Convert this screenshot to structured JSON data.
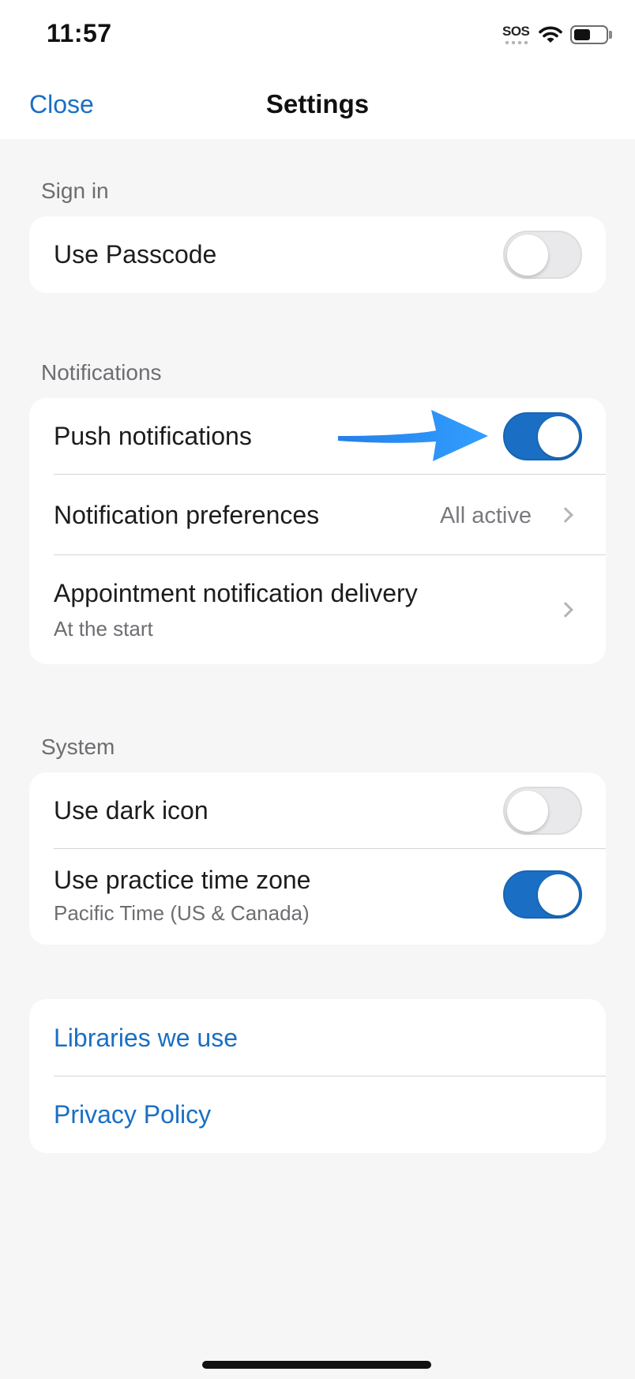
{
  "status_bar": {
    "time": "11:57",
    "sos_label": "SOS",
    "battery_level": 0.45,
    "wifi_icon": "wifi-icon",
    "battery_icon": "battery-icon"
  },
  "nav": {
    "close_label": "Close",
    "title": "Settings"
  },
  "sections": {
    "sign_in": {
      "header": "Sign in",
      "use_passcode": {
        "label": "Use Passcode",
        "enabled": false
      }
    },
    "notifications": {
      "header": "Notifications",
      "push": {
        "label": "Push notifications",
        "enabled": true
      },
      "preferences": {
        "label": "Notification preferences",
        "value": "All active"
      },
      "appointment_delivery": {
        "label": "Appointment notification delivery",
        "sub": "At the start"
      }
    },
    "system": {
      "header": "System",
      "dark_icon": {
        "label": "Use dark icon",
        "enabled": false
      },
      "practice_tz": {
        "label": "Use practice time zone",
        "sub": "Pacific Time (US & Canada)",
        "enabled": true
      }
    },
    "links": {
      "libraries": "Libraries we use",
      "privacy": "Privacy Policy"
    }
  },
  "colors": {
    "accent": "#1a6fc4",
    "annotation_arrow": "#1e90ff",
    "background": "#f6f6f6",
    "card": "#ffffff"
  }
}
